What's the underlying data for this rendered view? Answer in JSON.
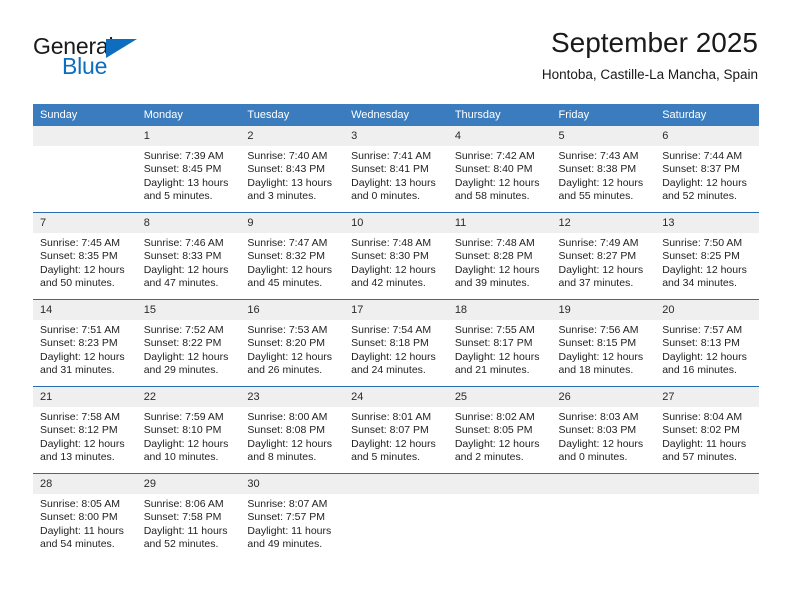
{
  "brand": {
    "name_part1": "General",
    "name_part2": "Blue",
    "triangle_icon": "triangle-icon",
    "accent_color": "#0d6ebf"
  },
  "header": {
    "title": "September 2025",
    "subtitle": "Hontoba, Castille-La Mancha, Spain"
  },
  "theme": {
    "header_row_bg": "#3a7cbe",
    "daynum_bg": "#efefef",
    "week_divider": "#2a6db0",
    "text": "#1f1f1f"
  },
  "weekday_headers": [
    "Sunday",
    "Monday",
    "Tuesday",
    "Wednesday",
    "Thursday",
    "Friday",
    "Saturday"
  ],
  "weeks": [
    [
      {
        "day": "",
        "sunrise": "",
        "sunset": "",
        "daylight1": "",
        "daylight2": "",
        "blank": true
      },
      {
        "day": "1",
        "sunrise": "Sunrise: 7:39 AM",
        "sunset": "Sunset: 8:45 PM",
        "daylight1": "Daylight: 13 hours",
        "daylight2": "and 5 minutes."
      },
      {
        "day": "2",
        "sunrise": "Sunrise: 7:40 AM",
        "sunset": "Sunset: 8:43 PM",
        "daylight1": "Daylight: 13 hours",
        "daylight2": "and 3 minutes."
      },
      {
        "day": "3",
        "sunrise": "Sunrise: 7:41 AM",
        "sunset": "Sunset: 8:41 PM",
        "daylight1": "Daylight: 13 hours",
        "daylight2": "and 0 minutes."
      },
      {
        "day": "4",
        "sunrise": "Sunrise: 7:42 AM",
        "sunset": "Sunset: 8:40 PM",
        "daylight1": "Daylight: 12 hours",
        "daylight2": "and 58 minutes."
      },
      {
        "day": "5",
        "sunrise": "Sunrise: 7:43 AM",
        "sunset": "Sunset: 8:38 PM",
        "daylight1": "Daylight: 12 hours",
        "daylight2": "and 55 minutes."
      },
      {
        "day": "6",
        "sunrise": "Sunrise: 7:44 AM",
        "sunset": "Sunset: 8:37 PM",
        "daylight1": "Daylight: 12 hours",
        "daylight2": "and 52 minutes."
      }
    ],
    [
      {
        "day": "7",
        "sunrise": "Sunrise: 7:45 AM",
        "sunset": "Sunset: 8:35 PM",
        "daylight1": "Daylight: 12 hours",
        "daylight2": "and 50 minutes."
      },
      {
        "day": "8",
        "sunrise": "Sunrise: 7:46 AM",
        "sunset": "Sunset: 8:33 PM",
        "daylight1": "Daylight: 12 hours",
        "daylight2": "and 47 minutes."
      },
      {
        "day": "9",
        "sunrise": "Sunrise: 7:47 AM",
        "sunset": "Sunset: 8:32 PM",
        "daylight1": "Daylight: 12 hours",
        "daylight2": "and 45 minutes."
      },
      {
        "day": "10",
        "sunrise": "Sunrise: 7:48 AM",
        "sunset": "Sunset: 8:30 PM",
        "daylight1": "Daylight: 12 hours",
        "daylight2": "and 42 minutes."
      },
      {
        "day": "11",
        "sunrise": "Sunrise: 7:48 AM",
        "sunset": "Sunset: 8:28 PM",
        "daylight1": "Daylight: 12 hours",
        "daylight2": "and 39 minutes."
      },
      {
        "day": "12",
        "sunrise": "Sunrise: 7:49 AM",
        "sunset": "Sunset: 8:27 PM",
        "daylight1": "Daylight: 12 hours",
        "daylight2": "and 37 minutes."
      },
      {
        "day": "13",
        "sunrise": "Sunrise: 7:50 AM",
        "sunset": "Sunset: 8:25 PM",
        "daylight1": "Daylight: 12 hours",
        "daylight2": "and 34 minutes."
      }
    ],
    [
      {
        "day": "14",
        "sunrise": "Sunrise: 7:51 AM",
        "sunset": "Sunset: 8:23 PM",
        "daylight1": "Daylight: 12 hours",
        "daylight2": "and 31 minutes."
      },
      {
        "day": "15",
        "sunrise": "Sunrise: 7:52 AM",
        "sunset": "Sunset: 8:22 PM",
        "daylight1": "Daylight: 12 hours",
        "daylight2": "and 29 minutes."
      },
      {
        "day": "16",
        "sunrise": "Sunrise: 7:53 AM",
        "sunset": "Sunset: 8:20 PM",
        "daylight1": "Daylight: 12 hours",
        "daylight2": "and 26 minutes."
      },
      {
        "day": "17",
        "sunrise": "Sunrise: 7:54 AM",
        "sunset": "Sunset: 8:18 PM",
        "daylight1": "Daylight: 12 hours",
        "daylight2": "and 24 minutes."
      },
      {
        "day": "18",
        "sunrise": "Sunrise: 7:55 AM",
        "sunset": "Sunset: 8:17 PM",
        "daylight1": "Daylight: 12 hours",
        "daylight2": "and 21 minutes."
      },
      {
        "day": "19",
        "sunrise": "Sunrise: 7:56 AM",
        "sunset": "Sunset: 8:15 PM",
        "daylight1": "Daylight: 12 hours",
        "daylight2": "and 18 minutes."
      },
      {
        "day": "20",
        "sunrise": "Sunrise: 7:57 AM",
        "sunset": "Sunset: 8:13 PM",
        "daylight1": "Daylight: 12 hours",
        "daylight2": "and 16 minutes."
      }
    ],
    [
      {
        "day": "21",
        "sunrise": "Sunrise: 7:58 AM",
        "sunset": "Sunset: 8:12 PM",
        "daylight1": "Daylight: 12 hours",
        "daylight2": "and 13 minutes."
      },
      {
        "day": "22",
        "sunrise": "Sunrise: 7:59 AM",
        "sunset": "Sunset: 8:10 PM",
        "daylight1": "Daylight: 12 hours",
        "daylight2": "and 10 minutes."
      },
      {
        "day": "23",
        "sunrise": "Sunrise: 8:00 AM",
        "sunset": "Sunset: 8:08 PM",
        "daylight1": "Daylight: 12 hours",
        "daylight2": "and 8 minutes."
      },
      {
        "day": "24",
        "sunrise": "Sunrise: 8:01 AM",
        "sunset": "Sunset: 8:07 PM",
        "daylight1": "Daylight: 12 hours",
        "daylight2": "and 5 minutes."
      },
      {
        "day": "25",
        "sunrise": "Sunrise: 8:02 AM",
        "sunset": "Sunset: 8:05 PM",
        "daylight1": "Daylight: 12 hours",
        "daylight2": "and 2 minutes."
      },
      {
        "day": "26",
        "sunrise": "Sunrise: 8:03 AM",
        "sunset": "Sunset: 8:03 PM",
        "daylight1": "Daylight: 12 hours",
        "daylight2": "and 0 minutes."
      },
      {
        "day": "27",
        "sunrise": "Sunrise: 8:04 AM",
        "sunset": "Sunset: 8:02 PM",
        "daylight1": "Daylight: 11 hours",
        "daylight2": "and 57 minutes."
      }
    ],
    [
      {
        "day": "28",
        "sunrise": "Sunrise: 8:05 AM",
        "sunset": "Sunset: 8:00 PM",
        "daylight1": "Daylight: 11 hours",
        "daylight2": "and 54 minutes."
      },
      {
        "day": "29",
        "sunrise": "Sunrise: 8:06 AM",
        "sunset": "Sunset: 7:58 PM",
        "daylight1": "Daylight: 11 hours",
        "daylight2": "and 52 minutes."
      },
      {
        "day": "30",
        "sunrise": "Sunrise: 8:07 AM",
        "sunset": "Sunset: 7:57 PM",
        "daylight1": "Daylight: 11 hours",
        "daylight2": "and 49 minutes."
      },
      {
        "day": "",
        "sunrise": "",
        "sunset": "",
        "daylight1": "",
        "daylight2": "",
        "blank": true
      },
      {
        "day": "",
        "sunrise": "",
        "sunset": "",
        "daylight1": "",
        "daylight2": "",
        "blank": true
      },
      {
        "day": "",
        "sunrise": "",
        "sunset": "",
        "daylight1": "",
        "daylight2": "",
        "blank": true
      },
      {
        "day": "",
        "sunrise": "",
        "sunset": "",
        "daylight1": "",
        "daylight2": "",
        "blank": true
      }
    ]
  ]
}
